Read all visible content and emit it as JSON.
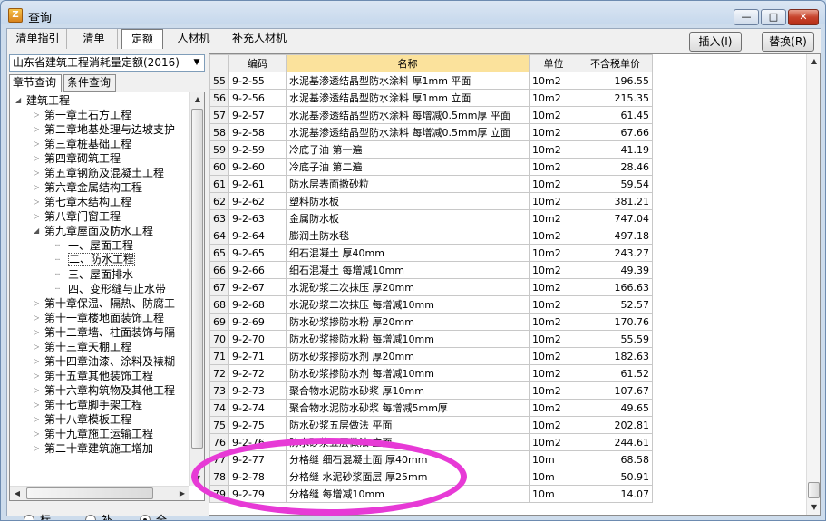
{
  "window": {
    "title": "查询",
    "min_glyph": "—",
    "max_glyph": "□",
    "close_glyph": "✕"
  },
  "tabs": [
    "清单指引",
    "清单",
    "定额",
    "人材机",
    "补充人材机"
  ],
  "buttons": {
    "insert": "插入(I)",
    "replace": "替换(R)"
  },
  "left": {
    "quota_select": "山东省建筑工程消耗量定额(2016)",
    "subtabs": [
      "章节查询",
      "条件查询"
    ],
    "tree": [
      {
        "label": "建筑工程",
        "level": 0,
        "expanded": true
      },
      {
        "label": "第一章土石方工程",
        "level": 1
      },
      {
        "label": "第二章地基处理与边坡支护",
        "level": 1
      },
      {
        "label": "第三章桩基础工程",
        "level": 1
      },
      {
        "label": "第四章砌筑工程",
        "level": 1
      },
      {
        "label": "第五章钢筋及混凝土工程",
        "level": 1
      },
      {
        "label": "第六章金属结构工程",
        "level": 1
      },
      {
        "label": "第七章木结构工程",
        "level": 1
      },
      {
        "label": "第八章门窗工程",
        "level": 1
      },
      {
        "label": "第九章屋面及防水工程",
        "level": 1,
        "expanded": true
      },
      {
        "label": "一、屋面工程",
        "level": 2
      },
      {
        "label": "二、防水工程",
        "level": 2,
        "selected": true
      },
      {
        "label": "三、屋面排水",
        "level": 2
      },
      {
        "label": "四、变形缝与止水带",
        "level": 2
      },
      {
        "label": "第十章保温、隔热、防腐工",
        "level": 1
      },
      {
        "label": "第十一章楼地面装饰工程",
        "level": 1
      },
      {
        "label": "第十二章墙、柱面装饰与隔",
        "level": 1
      },
      {
        "label": "第十三章天棚工程",
        "level": 1
      },
      {
        "label": "第十四章油漆、涂料及裱糊",
        "level": 1
      },
      {
        "label": "第十五章其他装饰工程",
        "level": 1
      },
      {
        "label": "第十六章构筑物及其他工程",
        "level": 1
      },
      {
        "label": "第十七章脚手架工程",
        "level": 1
      },
      {
        "label": "第十八章模板工程",
        "level": 1
      },
      {
        "label": "第十九章施工运输工程",
        "level": 1
      },
      {
        "label": "第二十章建筑施工增加",
        "level": 1
      }
    ],
    "radios": [
      {
        "label": "标准",
        "checked": false
      },
      {
        "label": "补充",
        "checked": false
      },
      {
        "label": "全部",
        "checked": true
      }
    ]
  },
  "grid": {
    "headers": [
      "编码",
      "名称",
      "单位",
      "不含税单价"
    ],
    "rows": [
      {
        "n": "55",
        "code": "9-2-55",
        "name": "水泥基渗透结晶型防水涂料 厚1mm 平面",
        "unit": "10m2",
        "price": "196.55"
      },
      {
        "n": "56",
        "code": "9-2-56",
        "name": "水泥基渗透结晶型防水涂料 厚1mm 立面",
        "unit": "10m2",
        "price": "215.35"
      },
      {
        "n": "57",
        "code": "9-2-57",
        "name": "水泥基渗透结晶型防水涂料 每增减0.5mm厚 平面",
        "unit": "10m2",
        "price": "61.45"
      },
      {
        "n": "58",
        "code": "9-2-58",
        "name": "水泥基渗透结晶型防水涂料 每增减0.5mm厚 立面",
        "unit": "10m2",
        "price": "67.66"
      },
      {
        "n": "59",
        "code": "9-2-59",
        "name": "冷底子油 第一遍",
        "unit": "10m2",
        "price": "41.19"
      },
      {
        "n": "60",
        "code": "9-2-60",
        "name": "冷底子油 第二遍",
        "unit": "10m2",
        "price": "28.46"
      },
      {
        "n": "61",
        "code": "9-2-61",
        "name": "防水层表面撒砂粒",
        "unit": "10m2",
        "price": "59.54"
      },
      {
        "n": "62",
        "code": "9-2-62",
        "name": "塑料防水板",
        "unit": "10m2",
        "price": "381.21"
      },
      {
        "n": "63",
        "code": "9-2-63",
        "name": "金属防水板",
        "unit": "10m2",
        "price": "747.04"
      },
      {
        "n": "64",
        "code": "9-2-64",
        "name": "膨润土防水毯",
        "unit": "10m2",
        "price": "497.18"
      },
      {
        "n": "65",
        "code": "9-2-65",
        "name": "细石混凝土 厚40mm",
        "unit": "10m2",
        "price": "243.27"
      },
      {
        "n": "66",
        "code": "9-2-66",
        "name": "细石混凝土 每增减10mm",
        "unit": "10m2",
        "price": "49.39"
      },
      {
        "n": "67",
        "code": "9-2-67",
        "name": "水泥砂浆二次抹压 厚20mm",
        "unit": "10m2",
        "price": "166.63"
      },
      {
        "n": "68",
        "code": "9-2-68",
        "name": "水泥砂浆二次抹压 每增减10mm",
        "unit": "10m2",
        "price": "52.57"
      },
      {
        "n": "69",
        "code": "9-2-69",
        "name": "防水砂浆掺防水粉 厚20mm",
        "unit": "10m2",
        "price": "170.76"
      },
      {
        "n": "70",
        "code": "9-2-70",
        "name": "防水砂浆掺防水粉 每增减10mm",
        "unit": "10m2",
        "price": "55.59"
      },
      {
        "n": "71",
        "code": "9-2-71",
        "name": "防水砂浆掺防水剂 厚20mm",
        "unit": "10m2",
        "price": "182.63"
      },
      {
        "n": "72",
        "code": "9-2-72",
        "name": "防水砂浆掺防水剂 每增减10mm",
        "unit": "10m2",
        "price": "61.52"
      },
      {
        "n": "73",
        "code": "9-2-73",
        "name": "聚合物水泥防水砂浆 厚10mm",
        "unit": "10m2",
        "price": "107.67"
      },
      {
        "n": "74",
        "code": "9-2-74",
        "name": "聚合物水泥防水砂浆 每增减5mm厚",
        "unit": "10m2",
        "price": "49.65"
      },
      {
        "n": "75",
        "code": "9-2-75",
        "name": "防水砂浆五层做法 平面",
        "unit": "10m2",
        "price": "202.81"
      },
      {
        "n": "76",
        "code": "9-2-76",
        "name": "防水砂浆五层做法 立面",
        "unit": "10m2",
        "price": "244.61"
      },
      {
        "n": "77",
        "code": "9-2-77",
        "name": "分格缝 细石混凝土面 厚40mm",
        "unit": "10m",
        "price": "68.58"
      },
      {
        "n": "78",
        "code": "9-2-78",
        "name": "分格缝 水泥砂浆面层 厚25mm",
        "unit": "10m",
        "price": "50.91"
      },
      {
        "n": "79",
        "code": "9-2-79",
        "name": "分格缝 每增减10mm",
        "unit": "10m",
        "price": "14.07"
      }
    ]
  },
  "annotation_color": "#e73ad6"
}
